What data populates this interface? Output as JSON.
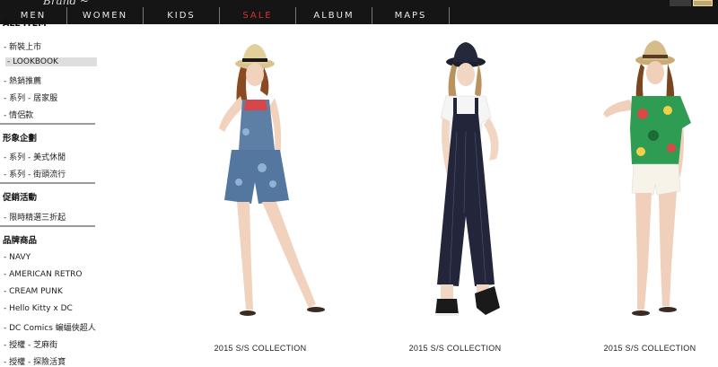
{
  "nav": {
    "items": [
      {
        "label": "MEN"
      },
      {
        "label": "WOMEN"
      },
      {
        "label": "KIDS"
      },
      {
        "label": "SALE",
        "color": "#d9312b"
      },
      {
        "label": "ALBUM"
      },
      {
        "label": "MAPS"
      }
    ]
  },
  "sidebar": {
    "cut_title": "ALL ITEM",
    "group1": [
      "- 新裝上市",
      "- LOOKBOOK",
      "- 熱銷推薦",
      "- 系列 - 居家服",
      "- 情侶款"
    ],
    "sec2_title": "形象企劃",
    "group2": [
      "- 系列 - 美式休閒",
      "- 系列 - 街頭流行"
    ],
    "sec3_title": "促銷活動",
    "group3": [
      "- 限時精選三折起"
    ],
    "sec4_title": "品牌商品",
    "group4": [
      "- NAVY",
      "- AMERICAN RETRO",
      "- CREAM PUNK",
      "- Hello Kitty x DC",
      "- DC Comics 蝙蝠俠超人",
      "- 授權 - 芝麻街",
      "- 授權 - 探險活寶"
    ]
  },
  "products": [
    {
      "caption": "2015 S/S COLLECTION",
      "image": "model-denim-romper-photo"
    },
    {
      "caption": "2015 S/S COLLECTION",
      "image": "model-striped-overalls-photo"
    },
    {
      "caption": "2015 S/S COLLECTION",
      "image": "model-tropical-top-photo"
    }
  ],
  "colors": {
    "topbar": "#151515",
    "sale": "#d9312b",
    "active_bg": "#dedede"
  }
}
